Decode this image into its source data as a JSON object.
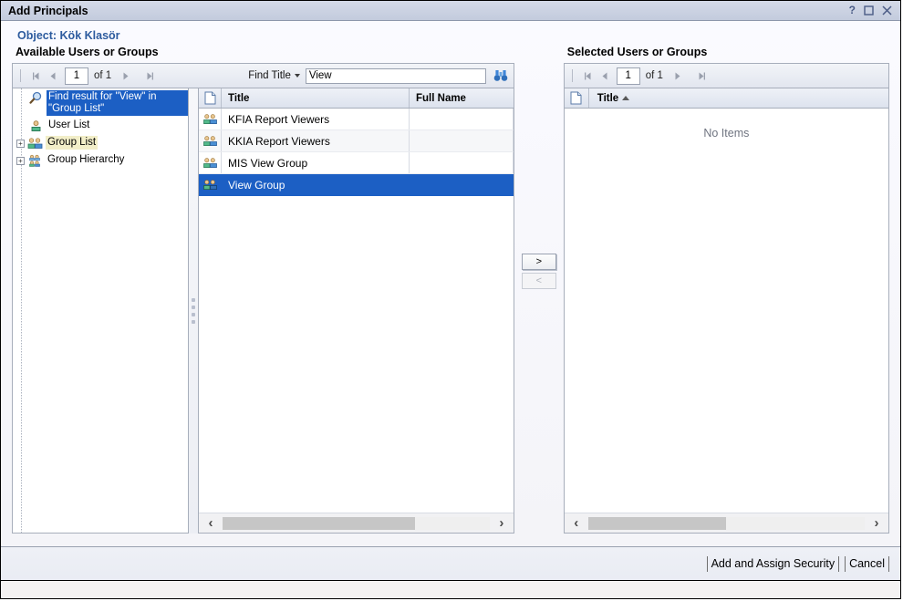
{
  "window": {
    "title": "Add Principals",
    "controls": [
      {
        "name": "help-icon",
        "label": "?"
      },
      {
        "name": "maximize-icon",
        "label": "□"
      },
      {
        "name": "close-icon",
        "label": "✕"
      }
    ]
  },
  "object_line": "Object: Kök Klasör",
  "left": {
    "heading": "Available Users or Groups",
    "pager": {
      "page": "1",
      "of": "of 1"
    },
    "find": {
      "label": "Find Title",
      "value": "View",
      "placeholder": "",
      "icon": "binoculars-icon"
    },
    "tree": [
      {
        "label": "Find result for \"View\" in \"Group List\"",
        "icon": "magnifier-icon",
        "state": "selected",
        "expander": ""
      },
      {
        "label": "User List",
        "icon": "user-icon",
        "state": "normal",
        "expander": ""
      },
      {
        "label": "Group List",
        "icon": "group-icon",
        "state": "hover",
        "expander": "+"
      },
      {
        "label": "Group Hierarchy",
        "icon": "group-hierarchy-icon",
        "state": "normal",
        "expander": "+"
      }
    ],
    "grid": {
      "columns": [
        "",
        "Title",
        "Full Name"
      ],
      "header_icon": "page-icon",
      "rows": [
        {
          "icon": "group-icon",
          "title": "KFIA Report Viewers",
          "full_name": "",
          "selected": false
        },
        {
          "icon": "group-icon",
          "title": "KKIA Report Viewers",
          "full_name": "",
          "selected": false
        },
        {
          "icon": "group-icon",
          "title": "MIS View Group",
          "full_name": "",
          "selected": false
        },
        {
          "icon": "group-icon",
          "title": "View Group",
          "full_name": "",
          "selected": true
        }
      ]
    },
    "scroll": {
      "left_arrow": "‹",
      "right_arrow": "›",
      "thumb_percent": 72
    }
  },
  "transfer": {
    "add_label": ">",
    "remove_label": "<"
  },
  "right": {
    "heading": "Selected Users or Groups",
    "pager": {
      "page": "1",
      "of": "of 1"
    },
    "grid": {
      "header_icon": "page-icon",
      "title_column": "Title",
      "sort": "ascending",
      "empty_text": "No Items"
    },
    "scroll": {
      "left_arrow": "‹",
      "right_arrow": "›",
      "thumb_percent": 50
    }
  },
  "footer": {
    "primary_label": "Add and Assign Security",
    "cancel_label": "Cancel"
  },
  "colors": {
    "selection_blue": "#1c5fc4",
    "heading_blue": "#2d5b9e",
    "titlebar": "#c9d1e0",
    "panel_border": "#a7aebb"
  }
}
